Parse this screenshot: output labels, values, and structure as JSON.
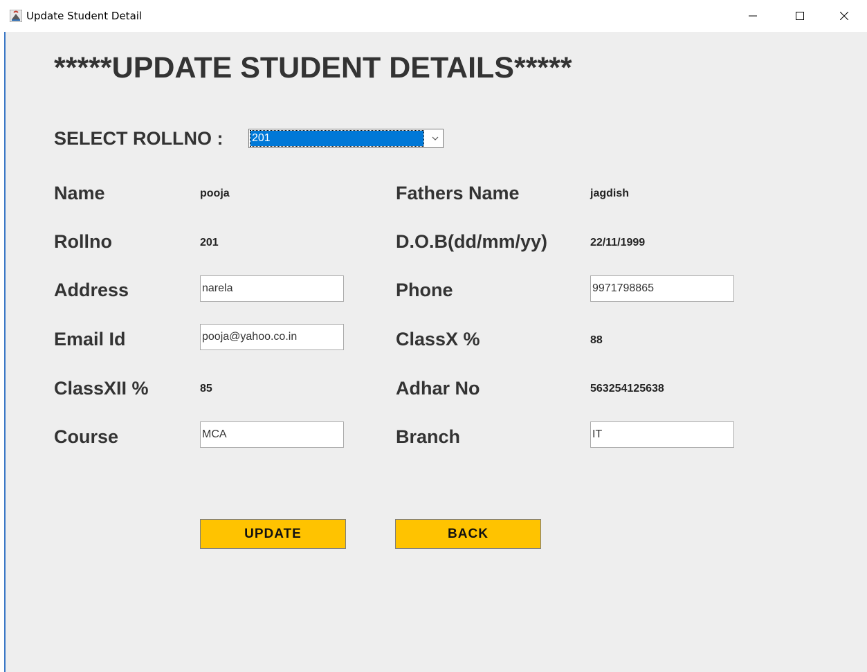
{
  "window": {
    "title": "Update Student Detail",
    "app_icon": "java-cup-icon",
    "controls": [
      "minimize-icon",
      "maximize-icon",
      "close-icon"
    ]
  },
  "heading": "*****UPDATE STUDENT DETAILS*****",
  "select_rollno": {
    "label": "SELECT ROLLNO :",
    "selected": "201"
  },
  "fields": {
    "name": {
      "label": "Name",
      "value": "pooja"
    },
    "fathers_name": {
      "label": "Fathers Name",
      "value": "jagdish"
    },
    "rollno": {
      "label": "Rollno",
      "value": "201"
    },
    "dob": {
      "label": "D.O.B(dd/mm/yy)",
      "value": "22/11/1999"
    },
    "address": {
      "label": "Address",
      "value": "narela"
    },
    "phone": {
      "label": "Phone",
      "value": "9971798865"
    },
    "email": {
      "label": "Email Id",
      "value": "pooja@yahoo.co.in"
    },
    "classx": {
      "label": "ClassX %",
      "value": "88"
    },
    "classxii": {
      "label": "ClassXII %",
      "value": "85"
    },
    "adhar": {
      "label": "Adhar No",
      "value": "563254125638"
    },
    "course": {
      "label": "Course",
      "value": "MCA"
    },
    "branch": {
      "label": "Branch",
      "value": "IT"
    }
  },
  "buttons": {
    "update": "UPDATE",
    "back": "BACK"
  },
  "colors": {
    "button_bg": "#ffc300",
    "selection_bg": "#0078d7",
    "panel_bg": "#eeeeee",
    "label_text": "#333333"
  }
}
